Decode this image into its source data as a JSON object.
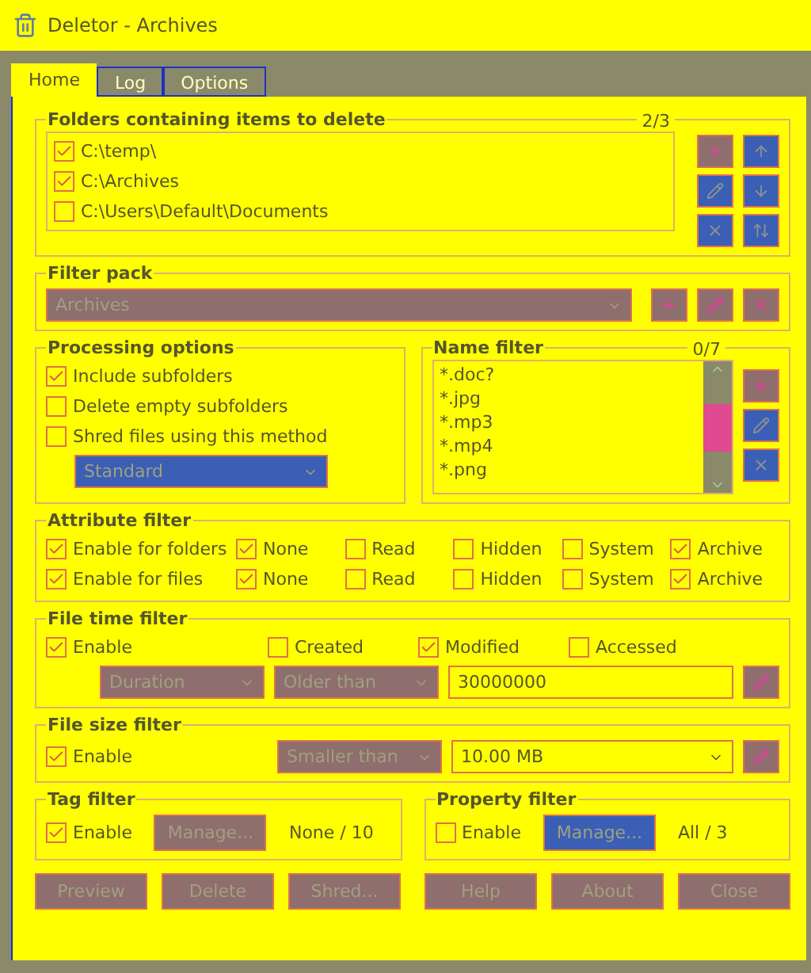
{
  "window": {
    "title": "Deletor - Archives"
  },
  "tabs": [
    {
      "label": "Home",
      "selected": true
    },
    {
      "label": "Log",
      "selected": false
    },
    {
      "label": "Options",
      "selected": false
    }
  ],
  "folders": {
    "title": "Folders containing items to delete",
    "count": "2/3",
    "items": [
      {
        "path": "C:\\temp\\",
        "checked": true
      },
      {
        "path": "C:\\Archives",
        "checked": true
      },
      {
        "path": "C:\\Users\\Default\\Documents",
        "checked": false
      }
    ],
    "buttons": [
      {
        "kind": "add",
        "disabled": false
      },
      {
        "kind": "up",
        "disabled": true
      },
      {
        "kind": "edit",
        "disabled": true
      },
      {
        "kind": "down",
        "disabled": true
      },
      {
        "kind": "remove",
        "disabled": true
      },
      {
        "kind": "sort",
        "disabled": true
      }
    ]
  },
  "filter_pack": {
    "title": "Filter pack",
    "value": "Archives",
    "buttons": [
      {
        "kind": "add",
        "disabled": false
      },
      {
        "kind": "edit",
        "disabled": false
      },
      {
        "kind": "remove",
        "disabled": false
      }
    ]
  },
  "processing": {
    "title": "Processing options",
    "options": [
      {
        "label": "Include subfolders",
        "checked": true
      },
      {
        "label": "Delete empty subfolders",
        "checked": false
      },
      {
        "label": "Shred files using this method",
        "checked": false
      }
    ],
    "method": {
      "value": "Standard",
      "disabled": true
    }
  },
  "name_filter": {
    "title": "Name filter",
    "count": "0/7",
    "items": [
      "*.doc?",
      "*.jpg",
      "*.mp3",
      "*.mp4",
      "*.png"
    ],
    "buttons": [
      {
        "kind": "add",
        "disabled": false
      },
      {
        "kind": "edit",
        "disabled": true
      },
      {
        "kind": "remove",
        "disabled": true
      }
    ]
  },
  "attribute_filter": {
    "title": "Attribute filter",
    "rows": [
      {
        "label": "Enable for folders",
        "checked": true,
        "attributes": [
          {
            "label": "None",
            "checked": true
          },
          {
            "label": "Read",
            "checked": false
          },
          {
            "label": "Hidden",
            "checked": false
          },
          {
            "label": "System",
            "checked": false
          },
          {
            "label": "Archive",
            "checked": true
          }
        ]
      },
      {
        "label": "Enable for files",
        "checked": true,
        "attributes": [
          {
            "label": "None",
            "checked": true
          },
          {
            "label": "Read",
            "checked": false
          },
          {
            "label": "Hidden",
            "checked": false
          },
          {
            "label": "System",
            "checked": false
          },
          {
            "label": "Archive",
            "checked": true
          }
        ]
      }
    ]
  },
  "time_filter": {
    "title": "File time filter",
    "enable": {
      "label": "Enable",
      "checked": true
    },
    "types": [
      {
        "label": "Created",
        "checked": false
      },
      {
        "label": "Modified",
        "checked": true
      },
      {
        "label": "Accessed",
        "checked": false
      }
    ],
    "mode": "Duration",
    "comparison": "Older than",
    "value": "30000000",
    "edit_button": {
      "kind": "edit",
      "disabled": false
    }
  },
  "size_filter": {
    "title": "File size filter",
    "enable": {
      "label": "Enable",
      "checked": true
    },
    "comparison": "Smaller than",
    "value": "10.00 MB",
    "edit_button": {
      "kind": "edit",
      "disabled": false
    }
  },
  "tag_filter": {
    "title": "Tag filter",
    "enable": {
      "label": "Enable",
      "checked": true
    },
    "button": {
      "label": "Manage...",
      "disabled": false
    },
    "status": "None / 10"
  },
  "property_filter": {
    "title": "Property filter",
    "enable": {
      "label": "Enable",
      "checked": false
    },
    "button": {
      "label": "Manage...",
      "disabled": true
    },
    "status": "All / 3"
  },
  "footer_buttons": [
    "Preview",
    "Delete",
    "Shred...",
    "Help",
    "About",
    "Close"
  ]
}
